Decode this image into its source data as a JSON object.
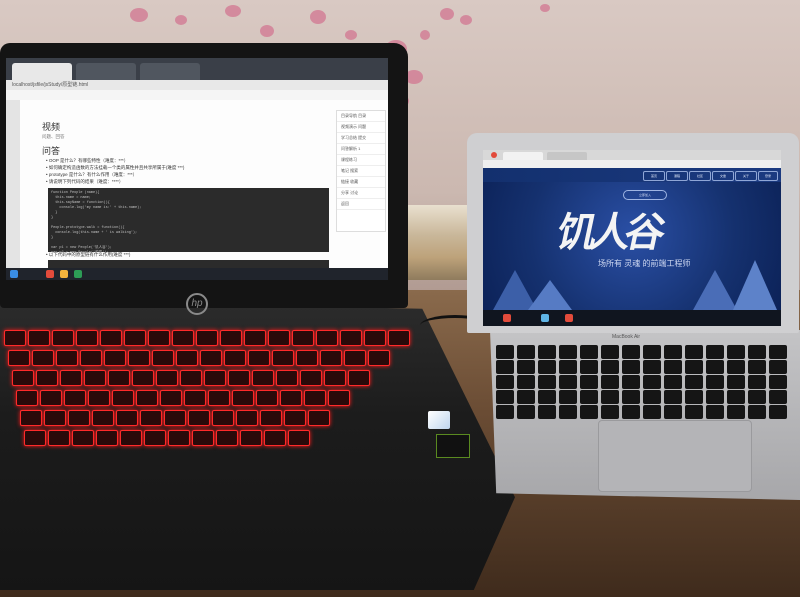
{
  "hp_laptop": {
    "browser_url": "localhost/jsfile/jsStudy/原型链.html",
    "page_section_1": "视频",
    "page_section_1_sub": "问题、回答",
    "page_section_2": "问答",
    "bullets": [
      "• OOP 是什么？有哪些特性（难度：***）",
      "• 如何确定构造函数的方法挂载一个类的属性并且共享所属于(难度 ***)",
      "• prototype 是什么？有什么作用（难度：***）",
      "• 请说明下列代码的结果（难度：****）"
    ],
    "code_block_1": [
      "function People (name){",
      "  this.name = name;",
      "  this.sayName = function(){",
      "    console.log('my name is:' + this.name);",
      "  }",
      "}",
      "",
      "People.prototype.walk = function(){",
      "  console.log(this.name + ' is walking');",
      "}",
      "",
      "var p1 = new People('饥人谷');",
      "var p2 = new People('前端');"
    ],
    "bullet_last": "• 以下代码中的原型链有什么作用(难度 ***)",
    "sidebar_items": [
      "目录导航 目录",
      "视频演示 问题",
      "学习总结 提交",
      "问答解析 1",
      "课程练习",
      "笔记 搜索",
      "链接 收藏",
      "分享 讨论",
      "返回"
    ],
    "brand_logo": "hp"
  },
  "macbook": {
    "site_title": "饥人谷",
    "site_subtitle": "场所有 灵魂 的前端工程师",
    "top_pill": "立即加入",
    "nav_items": [
      "首页",
      "课程",
      "社区",
      "文章",
      "关于",
      "登录"
    ],
    "brand": "MacBook Air"
  },
  "colors": {
    "keyboard_backlight": "#ff2a2a",
    "mac_screen_bg": "#15316f",
    "wall": "#d0bdb6"
  }
}
